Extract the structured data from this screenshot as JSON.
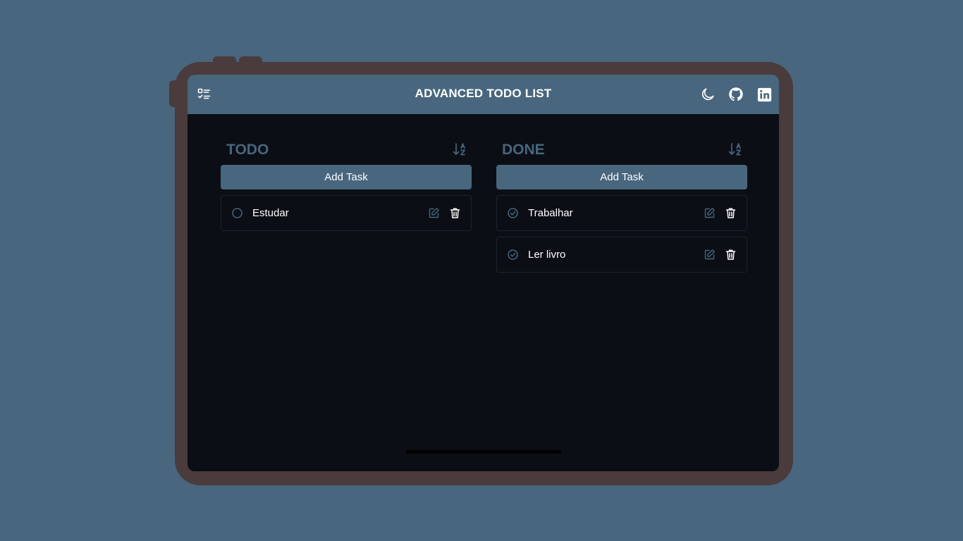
{
  "app": {
    "title": "ADVANCED TODO LIST",
    "icons": {
      "menu": "checklist-icon",
      "theme": "moon-icon",
      "github": "github-icon",
      "linkedin": "linkedin-icon"
    }
  },
  "colors": {
    "background": "#48667d",
    "device_frame": "#4a3b3c",
    "screen": "#0b0e15",
    "accent": "#48667d",
    "text": "#ffffff"
  },
  "columns": [
    {
      "title": "TODO",
      "add_label": "Add Task",
      "tasks": [
        {
          "label": "Estudar",
          "done": false
        }
      ]
    },
    {
      "title": "DONE",
      "add_label": "Add Task",
      "tasks": [
        {
          "label": "Trabalhar",
          "done": true
        },
        {
          "label": "Ler livro",
          "done": true
        }
      ]
    }
  ]
}
